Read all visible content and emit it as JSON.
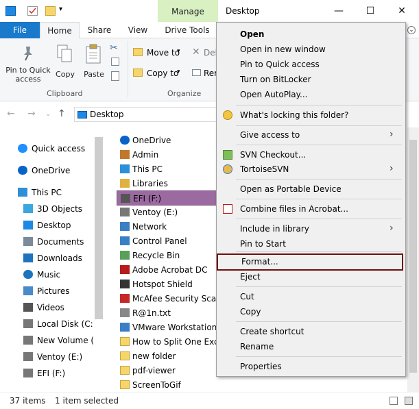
{
  "window": {
    "manage_tab": "Manage",
    "title": "Desktop"
  },
  "tabs": {
    "file": "File",
    "home": "Home",
    "share": "Share",
    "view": "View",
    "drive_tools": "Drive Tools"
  },
  "ribbon": {
    "pin_quick_access": "Pin to Quick access",
    "copy": "Copy",
    "paste": "Paste",
    "move_to": "Move to",
    "copy_to": "Copy to",
    "delete_partial": "Del",
    "rename_partial": "Rer",
    "clipboard_group": "Clipboard",
    "organize_group": "Organize"
  },
  "address": {
    "path": "Desktop"
  },
  "nav": [
    {
      "label": "Quick access",
      "icon": "star-icon",
      "color": "#1e90ff"
    },
    {
      "label": "OneDrive",
      "icon": "cloud-icon",
      "color": "#0a64c8"
    },
    {
      "label": "This PC",
      "icon": "computer-icon",
      "color": "#2d8fd8"
    },
    {
      "label": "3D Objects",
      "icon": "cube-icon",
      "color": "#3aa7e0"
    },
    {
      "label": "Desktop",
      "icon": "desktop-icon",
      "color": "#1e88e5"
    },
    {
      "label": "Documents",
      "icon": "document-icon",
      "color": "#7c8a99"
    },
    {
      "label": "Downloads",
      "icon": "download-icon",
      "color": "#1e73be"
    },
    {
      "label": "Music",
      "icon": "music-icon",
      "color": "#1e73be"
    },
    {
      "label": "Pictures",
      "icon": "picture-icon",
      "color": "#4a8ac9"
    },
    {
      "label": "Videos",
      "icon": "video-icon",
      "color": "#555555"
    },
    {
      "label": "Local Disk (C:)",
      "icon": "drive-icon",
      "color": "#777777"
    },
    {
      "label": "New Volume (D",
      "icon": "drive-icon",
      "color": "#777777"
    },
    {
      "label": "Ventoy (E:)",
      "icon": "drive-icon",
      "color": "#777777"
    },
    {
      "label": "EFI (F:)",
      "icon": "drive-icon",
      "color": "#777777"
    }
  ],
  "files": [
    {
      "label": "OneDrive",
      "icon": "cloud-icon",
      "color": "#0a64c8"
    },
    {
      "label": "Admin",
      "icon": "user-icon",
      "color": "#c0782c"
    },
    {
      "label": "This PC",
      "icon": "computer-icon",
      "color": "#2d8fd8"
    },
    {
      "label": "Libraries",
      "icon": "library-icon",
      "color": "#e0b040"
    },
    {
      "label": "EFI (F:)",
      "icon": "drive-icon",
      "color": "#555555"
    },
    {
      "label": "Ventoy (E:)",
      "icon": "drive-icon",
      "color": "#777777"
    },
    {
      "label": "Network",
      "icon": "network-icon",
      "color": "#3a7fc4"
    },
    {
      "label": "Control Panel",
      "icon": "control-panel-icon",
      "color": "#3a7fc4"
    },
    {
      "label": "Recycle Bin",
      "icon": "recycle-bin-icon",
      "color": "#5aa05a"
    },
    {
      "label": "Adobe Acrobat DC",
      "icon": "acrobat-icon",
      "color": "#b71c1c"
    },
    {
      "label": "Hotspot Shield",
      "icon": "shield-icon",
      "color": "#333333"
    },
    {
      "label": "McAfee Security Scan P",
      "icon": "mcafee-icon",
      "color": "#c62828"
    },
    {
      "label": "R@1n.txt",
      "icon": "text-file-icon",
      "color": "#888888"
    },
    {
      "label": "VMware Workstation Pr",
      "icon": "vmware-icon",
      "color": "#3a7fc4"
    },
    {
      "label": "How to Split One Excel",
      "icon": "folder-icon",
      "color": "#f6d66b"
    },
    {
      "label": "new folder",
      "icon": "folder-icon",
      "color": "#f6d66b"
    },
    {
      "label": "pdf-viewer",
      "icon": "folder-icon",
      "color": "#f6d66b"
    },
    {
      "label": "ScreenToGif",
      "icon": "folder-icon",
      "color": "#f6d66b"
    }
  ],
  "status": {
    "count": "37 items",
    "selected": "1 item selected"
  },
  "menu": {
    "open": "Open",
    "open_new_window": "Open in new window",
    "pin_quick_access": "Pin to Quick access",
    "bitlocker": "Turn on BitLocker",
    "autoplay": "Open AutoPlay...",
    "whats_locking": "What's locking this folder?",
    "give_access": "Give access to",
    "svn_checkout": "SVN Checkout...",
    "tortoisesvn": "TortoiseSVN",
    "portable_device": "Open as Portable Device",
    "combine_acrobat": "Combine files in Acrobat...",
    "include_library": "Include in library",
    "pin_start": "Pin to Start",
    "format": "Format...",
    "eject": "Eject",
    "cut": "Cut",
    "copy": "Copy",
    "create_shortcut": "Create shortcut",
    "rename": "Rename",
    "properties": "Properties"
  },
  "colors": {
    "file_tab": "#1979ca",
    "manage_tab": "#d9f0c2",
    "selection": "#9b6aa0",
    "format_highlight": "#6e1010"
  }
}
